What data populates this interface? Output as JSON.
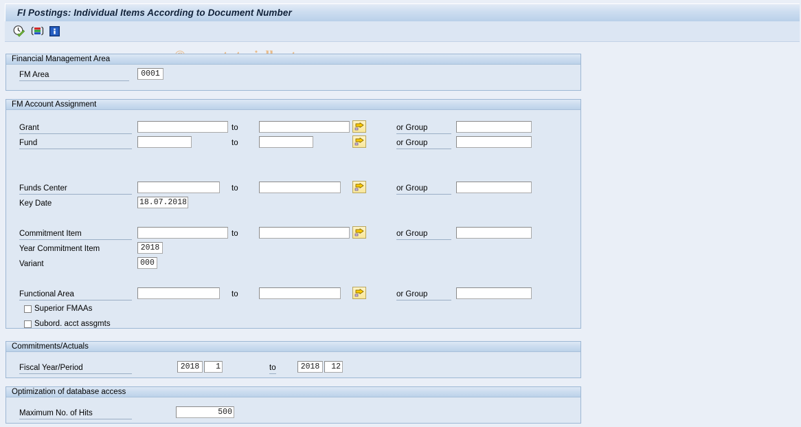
{
  "window": {
    "title": "FI Postings: Individual Items According to Document Number"
  },
  "watermark": {
    "text": "© www.tutorialkart.com"
  },
  "toolbar": {
    "items": [
      {
        "name": "execute-icon",
        "tooltip": "Execute"
      },
      {
        "name": "select-icon",
        "tooltip": "Multiple Selection"
      },
      {
        "name": "info-icon",
        "tooltip": "Information"
      }
    ]
  },
  "sections": {
    "fm_area": {
      "title": "Financial Management Area",
      "fm_area_label": "FM Area",
      "fm_area_value": "0001"
    },
    "fm_account_assignment": {
      "title": "FM Account Assignment",
      "to_label": "to",
      "or_group_label": "or Group",
      "grant": {
        "label": "Grant",
        "from": "",
        "to": "",
        "group": ""
      },
      "fund": {
        "label": "Fund",
        "from": "",
        "to": "",
        "group": ""
      },
      "funds_center": {
        "label": "Funds Center",
        "from": "",
        "to": "",
        "group": ""
      },
      "key_date": {
        "label": "Key Date",
        "value": "18.07.2018"
      },
      "commitment_item": {
        "label": "Commitment Item",
        "from": "",
        "to": "",
        "group": ""
      },
      "year_commitment_item": {
        "label": "Year Commitment Item",
        "value": "2018"
      },
      "variant": {
        "label": "Variant",
        "value": "000"
      },
      "functional_area": {
        "label": "Functional Area",
        "from": "",
        "to": "",
        "group": ""
      },
      "superior_fmaas": {
        "label": "Superior FMAAs",
        "checked": false
      },
      "subord_acct_assgmts": {
        "label": "Subord. acct assgmts",
        "checked": false
      }
    },
    "commitments_actuals": {
      "title": "Commitments/Actuals",
      "fiscal_year_period": {
        "label": "Fiscal Year/Period",
        "from_year": "2018",
        "from_period": "1",
        "to_label": "to",
        "to_year": "2018",
        "to_period": "12"
      }
    },
    "optimization": {
      "title": "Optimization of database access",
      "max_hits": {
        "label": "Maximum No. of Hits",
        "value": "500"
      }
    }
  },
  "colors": {
    "title_bar": "#cdddf0",
    "panel_body": "#dfe8f3",
    "panel_border": "#9db7d4",
    "page_background": "#eaeff7",
    "watermark": "#e8bb8a",
    "multiselect_button": "#f8e79b"
  }
}
